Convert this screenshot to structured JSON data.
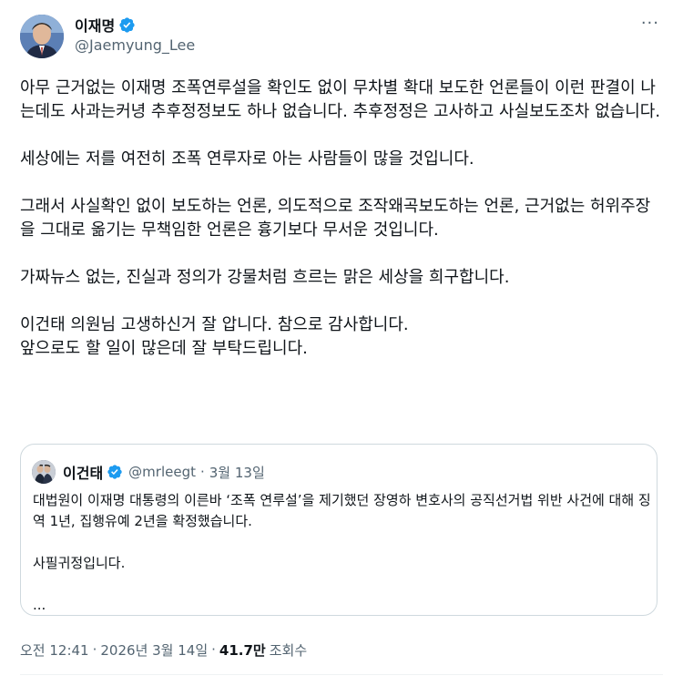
{
  "author": {
    "display_name": "이재명",
    "handle": "@Jaemyung_Lee",
    "verified_icon": "verified-badge-icon",
    "accent": "#1d9bf0"
  },
  "more_label": "···",
  "tweet": {
    "paragraphs": [
      "아무 근거없는 이재명 조폭연루설을 확인도 없이 무차별 확대 보도한 언론들이 이런 판결이 나는데도 사과는커녕 추후정정보도 하나 없습니다. 추후정정은 고사하고 사실보도조차 없습니다.",
      "세상에는 저를 여전히 조폭 연루자로 아는 사람들이 많을 것입니다.",
      "그래서 사실확인 없이 보도하는 언론, 의도적으로 조작왜곡보도하는 언론, 근거없는 허위주장을 그대로 옮기는 무책임한 언론은 흉기보다 무서운 것입니다.",
      "가짜뉴스 없는, 진실과 정의가 강물처럼 흐르는 맑은 세상을 희구합니다.",
      "이건태 의원님 고생하신거 잘 압니다. 참으로 감사합니다.",
      "앞으로도 할 일이 많은데 잘 부탁드립니다."
    ]
  },
  "quote": {
    "display_name": "이건태",
    "handle": "@mrleegt",
    "dot": "·",
    "date": "3월 13일",
    "paragraphs": [
      "대법원이 이재명 대통령의 이른바 ‘조폭 연루설’을 제기했던 장영하 변호사의 공직선거법 위반 사건에 대해 징역 1년, 집행유예 2년을 확정했습니다.",
      "사필귀정입니다.",
      "..."
    ]
  },
  "meta": {
    "time": "오전 12:41",
    "sep": "·",
    "date": "2026년 3월 14일",
    "views_count": "41.7만",
    "views_label": "조회수"
  }
}
